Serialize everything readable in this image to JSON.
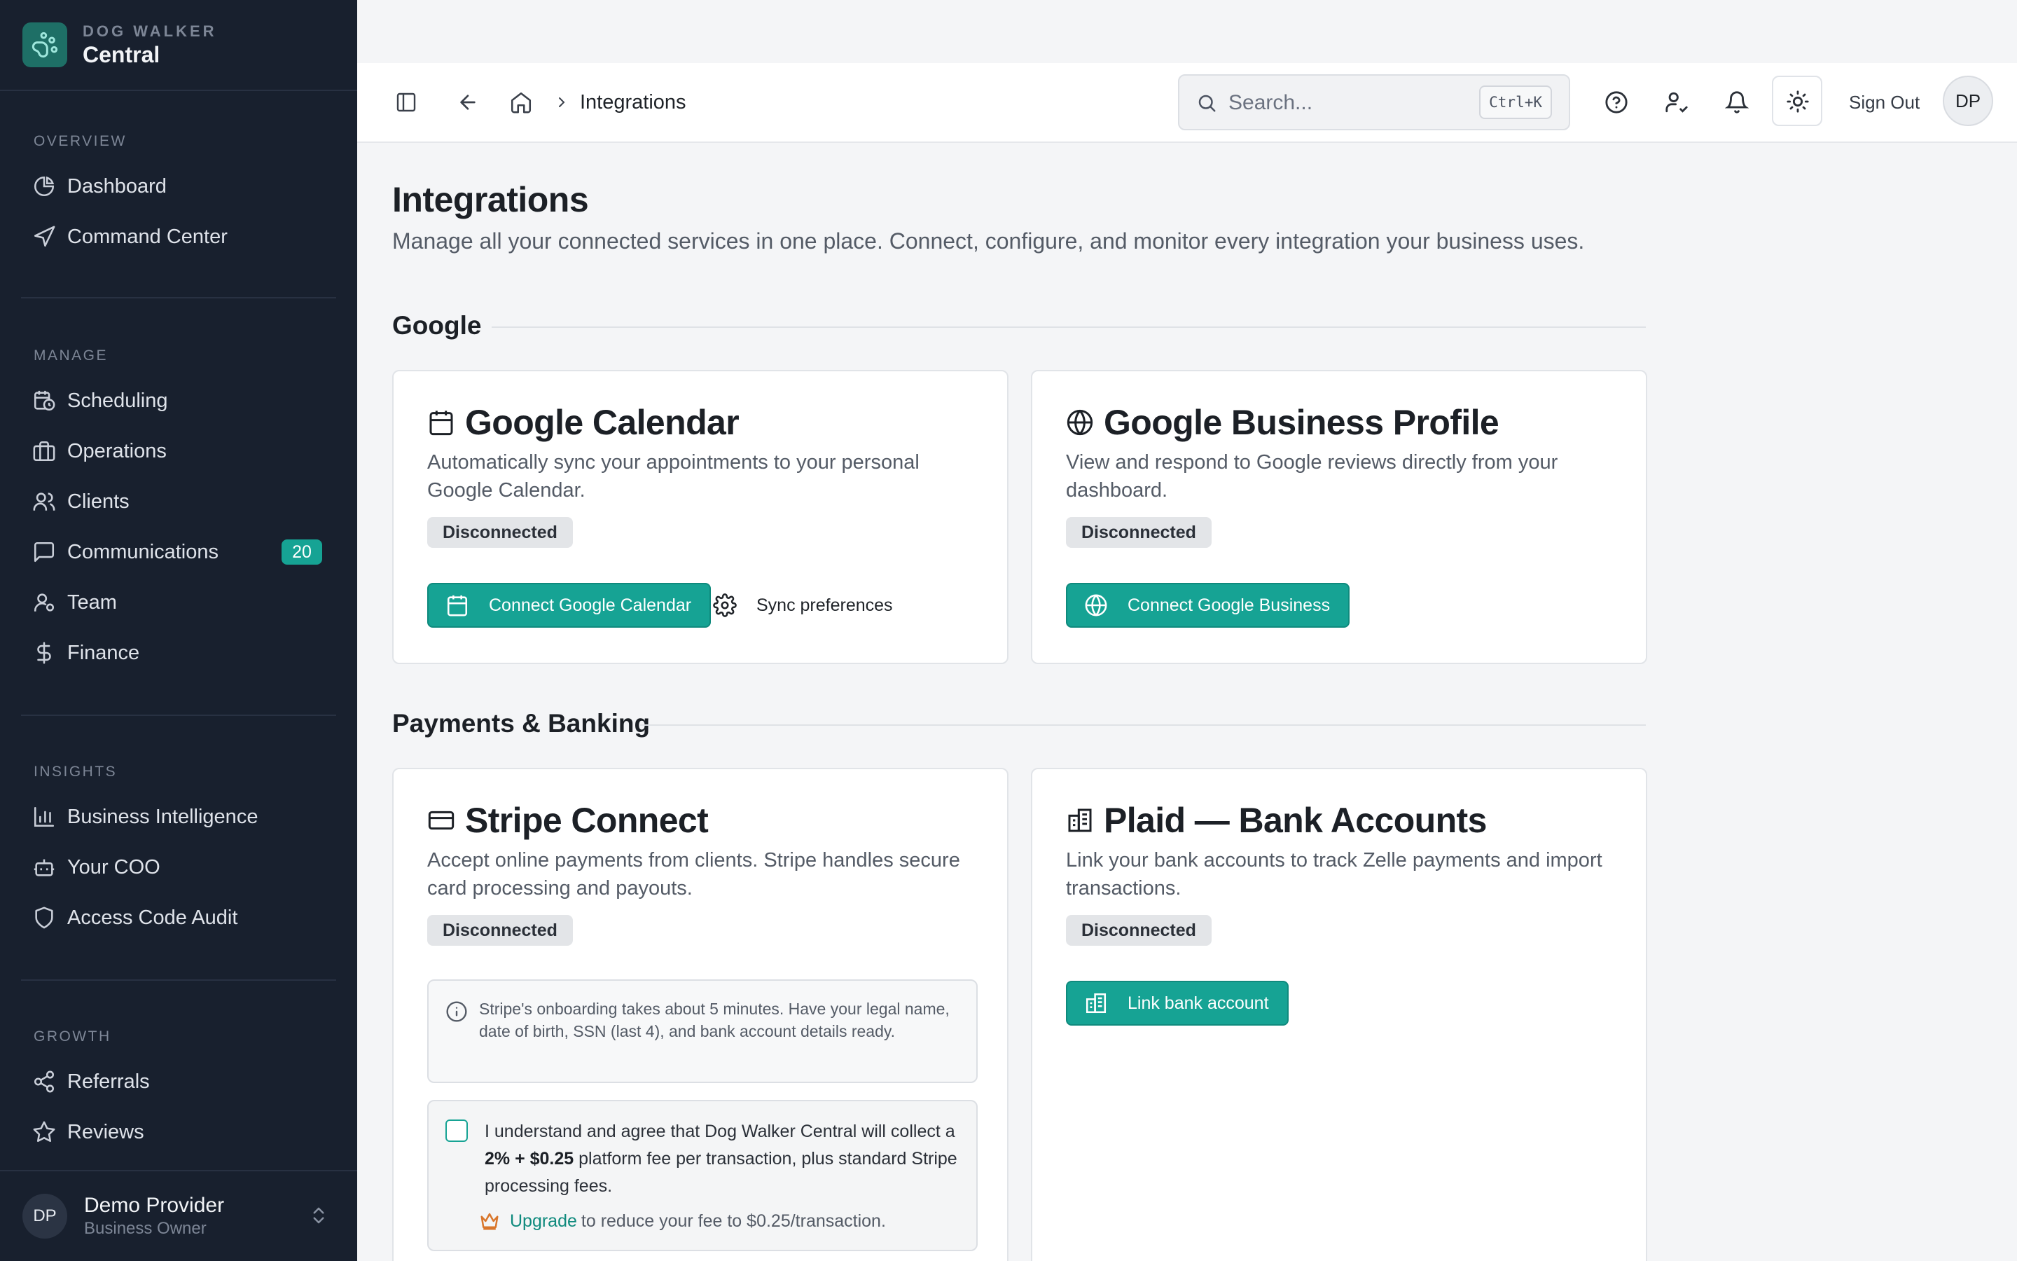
{
  "brand": {
    "sub": "DOG WALKER",
    "name": "Central"
  },
  "sidebar": {
    "sections": [
      {
        "heading": "OVERVIEW",
        "items": [
          {
            "label": "Dashboard"
          },
          {
            "label": "Command Center"
          }
        ]
      },
      {
        "heading": "MANAGE",
        "items": [
          {
            "label": "Scheduling"
          },
          {
            "label": "Operations"
          },
          {
            "label": "Clients"
          },
          {
            "label": "Communications",
            "badge": "20"
          },
          {
            "label": "Team"
          },
          {
            "label": "Finance"
          }
        ]
      },
      {
        "heading": "INSIGHTS",
        "items": [
          {
            "label": "Business Intelligence"
          },
          {
            "label": "Your COO"
          },
          {
            "label": "Access Code Audit"
          }
        ]
      },
      {
        "heading": "GROWTH",
        "items": [
          {
            "label": "Referrals"
          },
          {
            "label": "Reviews"
          }
        ]
      }
    ],
    "user": {
      "initials": "DP",
      "name": "Demo Provider",
      "role": "Business Owner"
    }
  },
  "topbar": {
    "breadcrumb": "Integrations",
    "search_placeholder": "Search...",
    "search_shortcut": "Ctrl+K",
    "sign_out": "Sign Out",
    "avatar_initials": "DP"
  },
  "page": {
    "title": "Integrations",
    "subtitle": "Manage all your connected services in one place. Connect, configure, and monitor every integration your business uses."
  },
  "sections": {
    "google": {
      "title": "Google",
      "calendar": {
        "title": "Google Calendar",
        "description": "Automatically sync your appointments to your personal Google Calendar.",
        "status": "Disconnected",
        "connect_label": "Connect Google Calendar",
        "sync_label": "Sync preferences"
      },
      "business": {
        "title": "Google Business Profile",
        "description": "View and respond to Google reviews directly from your dashboard.",
        "status": "Disconnected",
        "connect_label": "Connect Google Business"
      }
    },
    "payments": {
      "title": "Payments & Banking",
      "stripe": {
        "title": "Stripe Connect",
        "description": "Accept online payments from clients. Stripe handles secure card processing and payouts.",
        "status": "Disconnected",
        "info": "Stripe's onboarding takes about 5 minutes. Have your legal name, date of birth, SSN (last 4), and bank account details ready.",
        "agree_pre": "I understand and agree that Dog Walker Central will collect a",
        "agree_fee": "2% + $0.25",
        "agree_post": "platform fee per transaction, plus standard Stripe processing fees.",
        "upgrade_link": "Upgrade",
        "upgrade_text": "to reduce your fee to $0.25/transaction."
      },
      "plaid": {
        "title": "Plaid — Bank Accounts",
        "description": "Link your bank accounts to track Zelle payments and import transactions.",
        "status": "Disconnected",
        "link_label": "Link bank account"
      }
    }
  },
  "colors": {
    "sidebar_bg": "#18202e",
    "accent": "#16a394",
    "page_bg": "#f4f5f7"
  }
}
